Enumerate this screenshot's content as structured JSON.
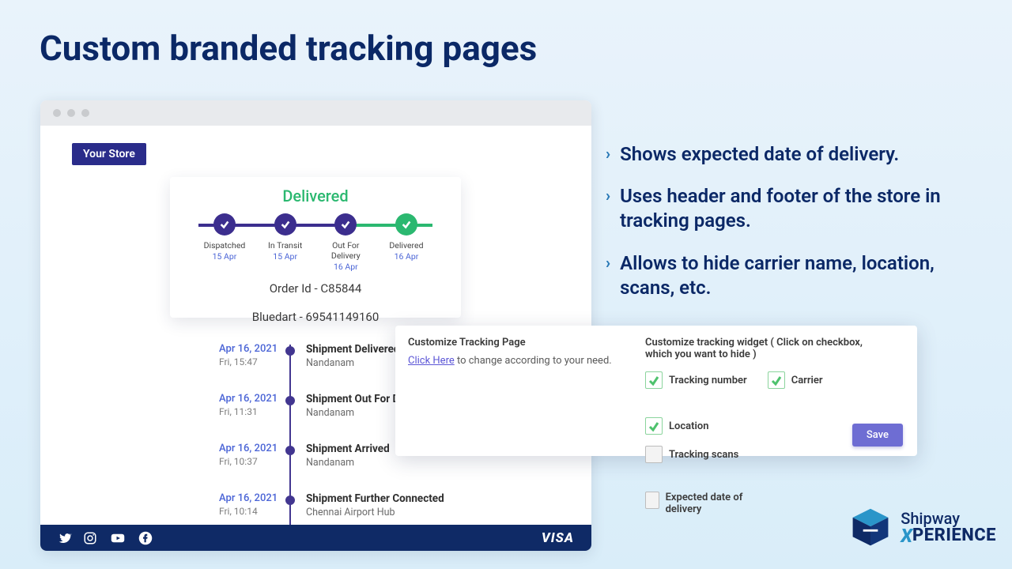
{
  "page_title": "Custom branded tracking pages",
  "browser": {
    "store_badge": "Your Store",
    "status_title": "Delivered",
    "steps": [
      {
        "label": "Dispatched",
        "date": "15 Apr"
      },
      {
        "label": "In Transit",
        "date": "15 Apr"
      },
      {
        "label": "Out For Delivery",
        "date": "16 Apr"
      },
      {
        "label": "Delivered",
        "date": "16 Apr"
      }
    ],
    "order_id": "Order Id - C85844",
    "carrier_line": "Bluedart - 69541149160",
    "timeline": [
      {
        "date": "Apr 16, 2021",
        "time": "Fri, 15:47",
        "title": "Shipment Delivered",
        "loc": "Nandanam"
      },
      {
        "date": "Apr 16, 2021",
        "time": "Fri, 11:31",
        "title": "Shipment Out For Delivery",
        "loc": "Nandanam"
      },
      {
        "date": "Apr 16, 2021",
        "time": "Fri, 10:37",
        "title": "Shipment Arrived",
        "loc": "Nandanam"
      },
      {
        "date": "Apr 16, 2021",
        "time": "Fri, 10:14",
        "title": "Shipment Further Connected",
        "loc": "Chennai Airport Hub"
      }
    ],
    "footer_brand": "VISA"
  },
  "settings": {
    "left_header": "Customize Tracking Page",
    "left_link_prefix": "Click Here",
    "left_link_suffix": " to change according to your need.",
    "right_header": "Customize tracking widget ( Click on checkbox, which you want to hide )",
    "checks_row1": [
      {
        "label": "Tracking number",
        "checked": true
      },
      {
        "label": "Carrier",
        "checked": true
      },
      {
        "label": "Location",
        "checked": true
      }
    ],
    "checks_row2": [
      {
        "label": "Tracking scans",
        "checked": false
      },
      {
        "label": "Expected date of delivery",
        "checked": false
      }
    ],
    "save_label": "Save"
  },
  "bullets": [
    "Shows expected date of delivery.",
    "Uses header and footer of the store in tracking pages.",
    "Allows to hide carrier name, location, scans, etc."
  ],
  "logo": {
    "line1": "Shipway",
    "line2_x": "X",
    "line2_rest": "PERIENCE"
  }
}
